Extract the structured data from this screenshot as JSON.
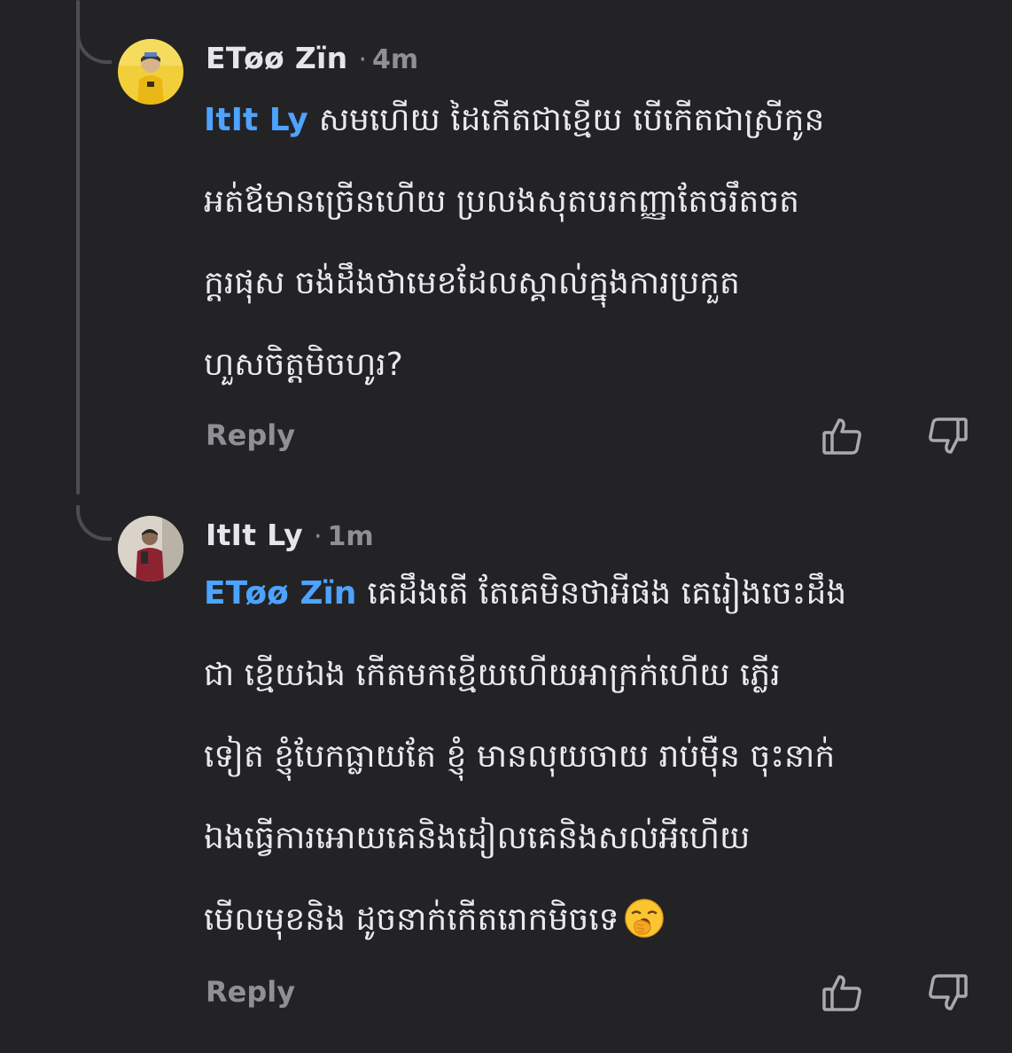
{
  "comments": [
    {
      "author": "ETøø Zïn",
      "time": "4m",
      "mention": "ItIt Ly",
      "body_lines": [
        "សមហើយ ដៃកើតជាខ្មើយ បើកើតជាស្រីកូន",
        "អត់ឪមានច្រើនហើយ ប្រលងសុតបរកញ្ញាតែចរឹតចត",
        "ក្តរផុស ចង់ដឹងថាមេខដែលស្គាល់ក្នុងការប្រកួត",
        "ហួសចិត្តមិចហូរ?"
      ],
      "reply_label": "Reply"
    },
    {
      "author": "ItIt Ly",
      "time": "1m",
      "mention": "ETøø Zïn",
      "body_lines": [
        "គេដឹងតើ តែគេមិនថាអីផង គេរៀងចេះដឹង",
        "ជា ខ្មើយឯង កើតមកខ្មើយហើយអាក្រក់ហើយ ភ្លើរ",
        "ទៀត ខ្ញុំបែកធ្លាយតែ ខ្ញុំ មានលុយចាយ រាប់ម៉ឺន ចុះនាក់",
        "ឯងធ្វើការអោយគេនិងដៀលគេនិងសល់អីហើយ",
        "មើលមុខនិង ដូចនាក់កើតរោកមិចទេ"
      ],
      "emoji": "yawning-face",
      "reply_label": "Reply"
    }
  ],
  "colors": {
    "background": "#232325",
    "mention": "#4da3ff",
    "text": "#e9eaee",
    "muted": "#8e9096",
    "thread_line": "#4c4d52"
  }
}
